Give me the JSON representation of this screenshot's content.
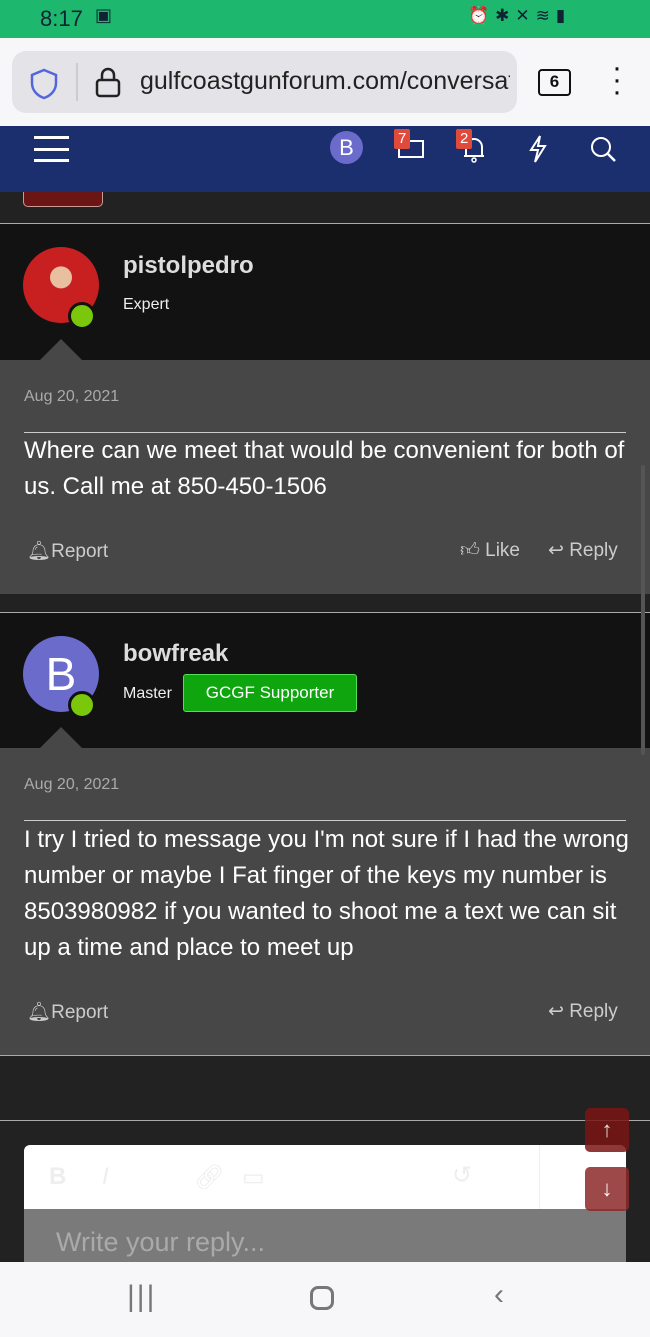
{
  "status_bar": {
    "time": "8:17"
  },
  "browser": {
    "url": "gulfcoastgunforum.com/conversations",
    "tab_count": "6"
  },
  "nav": {
    "avatar_letter": "B",
    "inbox_count": "7",
    "alerts_count": "2"
  },
  "posts": [
    {
      "username": "pistolpedro",
      "user_title": "Expert",
      "date": "Aug 20, 2021",
      "message": "Where can we meet that would be convenient for both of us. Call me at 850-450-1506",
      "report": "Report",
      "like": "Like",
      "reply": "Reply"
    },
    {
      "username": "bowfreak",
      "avatar_letter": "B",
      "user_title": "Master",
      "banner": "GCGF Supporter",
      "date": "Aug 20, 2021",
      "message": "I try I tried to message you I'm not sure if I had the wrong number or maybe I Fat finger of the keys my number is 8503980982 if you wanted to shoot me a text we can sit up a time and place to meet up",
      "report": "Report",
      "reply": "Reply"
    }
  ],
  "editor": {
    "placeholder": "Write your reply..."
  },
  "colors": {
    "accent": "#1b2f6f",
    "status_bar": "#1db86e",
    "supporter": "#0fa50f",
    "online": "#7ac70c"
  }
}
